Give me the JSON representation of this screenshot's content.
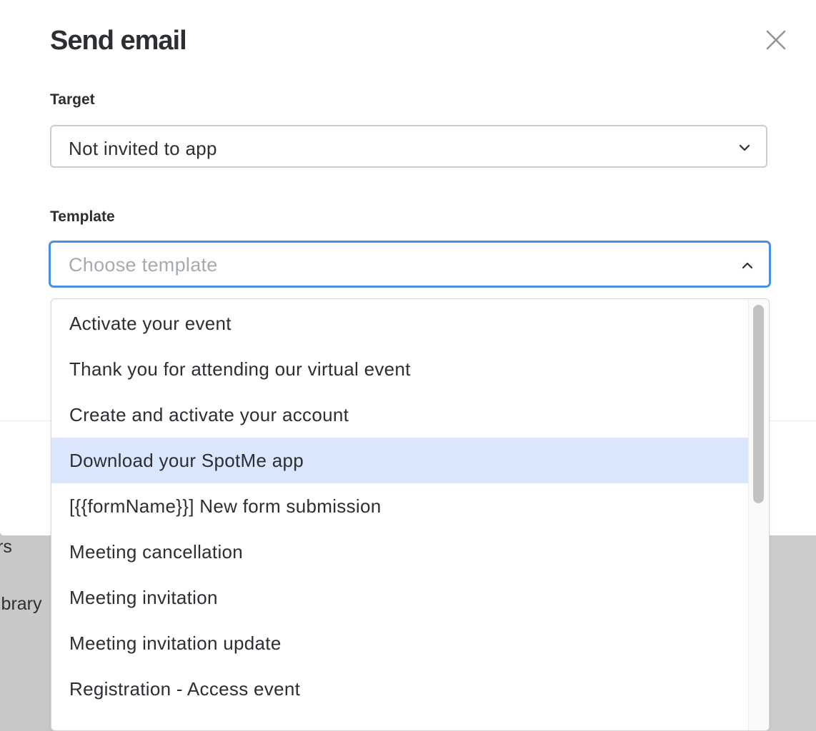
{
  "background": {
    "items": [
      "rs",
      "ibrary"
    ]
  },
  "modal": {
    "title": "Send email",
    "close_icon": "close-icon"
  },
  "target": {
    "label": "Target",
    "value": "Not invited to app"
  },
  "template": {
    "label": "Template",
    "placeholder": "Choose template",
    "value": "",
    "options": [
      "Activate your event",
      "Thank you for attending our virtual event",
      "Create and activate your account",
      "Download your SpotMe app",
      "[{{formName}}] New form submission",
      "Meeting cancellation",
      "Meeting invitation",
      "Meeting invitation update",
      "Registration - Access event"
    ],
    "highlighted": "Download your SpotMe app"
  },
  "colors": {
    "accent": "#4a8fe6",
    "highlight": "#dae6fc"
  }
}
